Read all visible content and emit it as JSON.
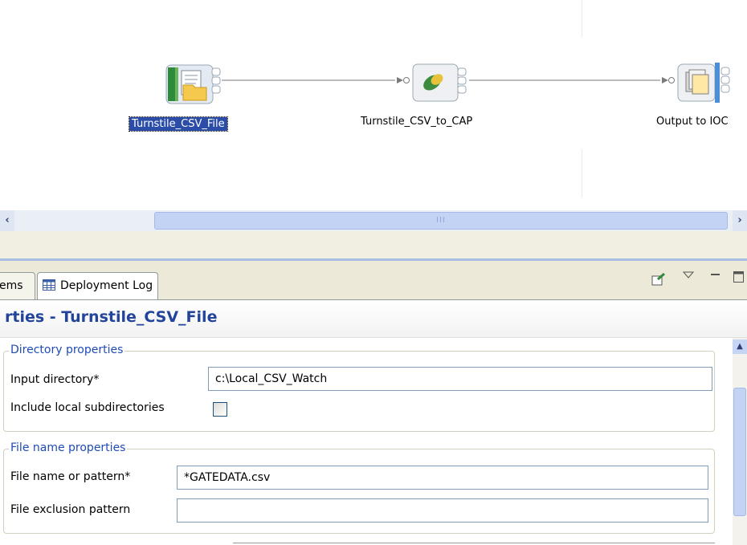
{
  "canvas": {
    "nodes": [
      {
        "label": "Turnstile_CSV_File",
        "icon": "file-folder-icon",
        "selected": true
      },
      {
        "label": "Turnstile_CSV_to_CAP",
        "icon": "transform-icon",
        "selected": false
      },
      {
        "label": "Output to IOC",
        "icon": "document-output-icon",
        "selected": false
      }
    ]
  },
  "scrollbar": {
    "grip": "III"
  },
  "view_tabs": {
    "problems_label": "ems",
    "deployment_log_label": "Deployment Log",
    "icons": [
      "pin-icon",
      "view-menu-icon",
      "minimize-icon",
      "maximize-icon"
    ]
  },
  "properties": {
    "title": "rties - Turnstile_CSV_File",
    "directory_group": {
      "legend": "Directory properties",
      "input_directory_label": "Input directory*",
      "input_directory_value": "c:\\Local_CSV_Watch",
      "include_subdirs_label": "Include local subdirectories",
      "include_subdirs_checked": false
    },
    "filename_group": {
      "legend": "File name properties",
      "pattern_label": "File name or pattern*",
      "pattern_value": "*GATEDATA.csv",
      "exclusion_label": "File exclusion pattern",
      "exclusion_value": ""
    }
  },
  "colors": {
    "accent": "#22449b",
    "legend": "#1f4bb5",
    "selection": "#2b4da8"
  }
}
